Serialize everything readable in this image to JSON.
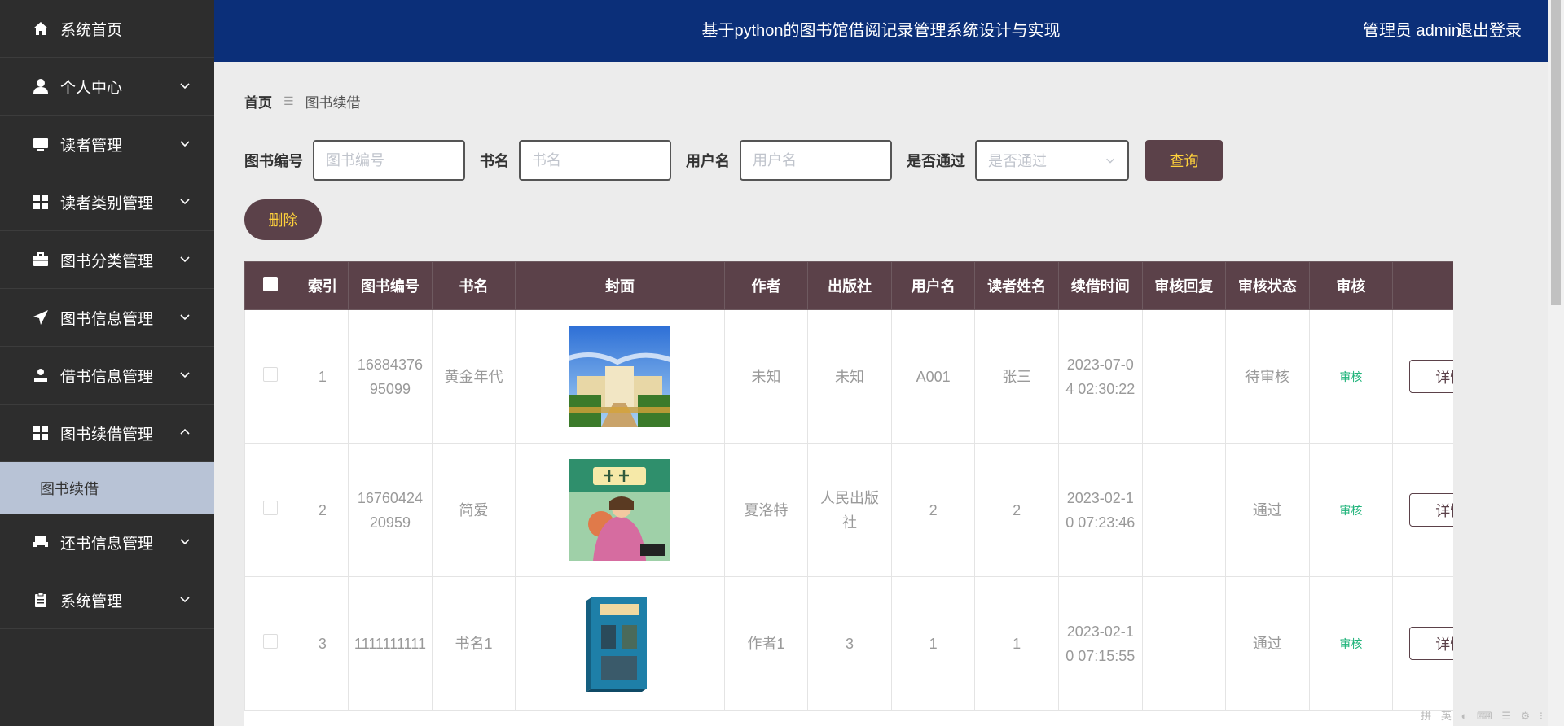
{
  "sidebar": {
    "items": [
      {
        "label": "系统首页",
        "icon": "home-icon"
      },
      {
        "label": "个人中心",
        "icon": "user-icon"
      },
      {
        "label": "读者管理",
        "icon": "monitor-icon"
      },
      {
        "label": "读者类别管理",
        "icon": "grid-icon"
      },
      {
        "label": "图书分类管理",
        "icon": "briefcase-icon"
      },
      {
        "label": "图书信息管理",
        "icon": "send-icon"
      },
      {
        "label": "借书信息管理",
        "icon": "person-icon"
      },
      {
        "label": "图书续借管理",
        "icon": "grid-icon"
      },
      {
        "label": "还书信息管理",
        "icon": "printer-icon"
      },
      {
        "label": "系统管理",
        "icon": "clipboard-icon"
      }
    ],
    "submenu": {
      "label": "图书续借"
    }
  },
  "header": {
    "title": "基于python的图书馆借阅记录管理系统设计与实现",
    "user": "管理员 admin",
    "logout": "退出登录",
    "bg_color": "#0b2f79"
  },
  "breadcrumb": {
    "home": "首页",
    "current": "图书续借"
  },
  "filters": {
    "book_no_label": "图书编号",
    "book_no_placeholder": "图书编号",
    "book_name_label": "书名",
    "book_name_placeholder": "书名",
    "username_label": "用户名",
    "username_placeholder": "用户名",
    "passed_label": "是否通过",
    "passed_placeholder": "是否通过",
    "query_button": "查询"
  },
  "delete_button": "删除",
  "table": {
    "headers": [
      "索引",
      "图书编号",
      "书名",
      "封面",
      "作者",
      "出版社",
      "用户名",
      "读者姓名",
      "续借时间",
      "审核回复",
      "审核状态",
      "审核"
    ],
    "rows": [
      {
        "index": "1",
        "book_no": "1688437695099",
        "name": "黄金年代",
        "author": "未知",
        "publisher": "未知",
        "username": "A001",
        "reader": "张三",
        "time": "2023-07-04 02:30:22",
        "reply": "",
        "status": "待审核",
        "audit": "审核",
        "detail": "详情"
      },
      {
        "index": "2",
        "book_no": "1676042420959",
        "name": "简爱",
        "author": "夏洛特",
        "publisher": "人民出版社",
        "username": "2",
        "reader": "2",
        "time": "2023-02-10 07:23:46",
        "reply": "",
        "status": "通过",
        "audit": "审核",
        "detail": "详情"
      },
      {
        "index": "3",
        "book_no": "1111111111",
        "name": "书名1",
        "author": "作者1",
        "publisher": "3",
        "username": "1",
        "reader": "1",
        "time": "2023-02-10 07:15:55",
        "reply": "",
        "status": "通过",
        "audit": "审核",
        "detail": "详情"
      }
    ],
    "header_color": "#5b4149"
  },
  "ime_bar": "拼 英 ◐ ⌨ ☰ ⚙ ⁝"
}
